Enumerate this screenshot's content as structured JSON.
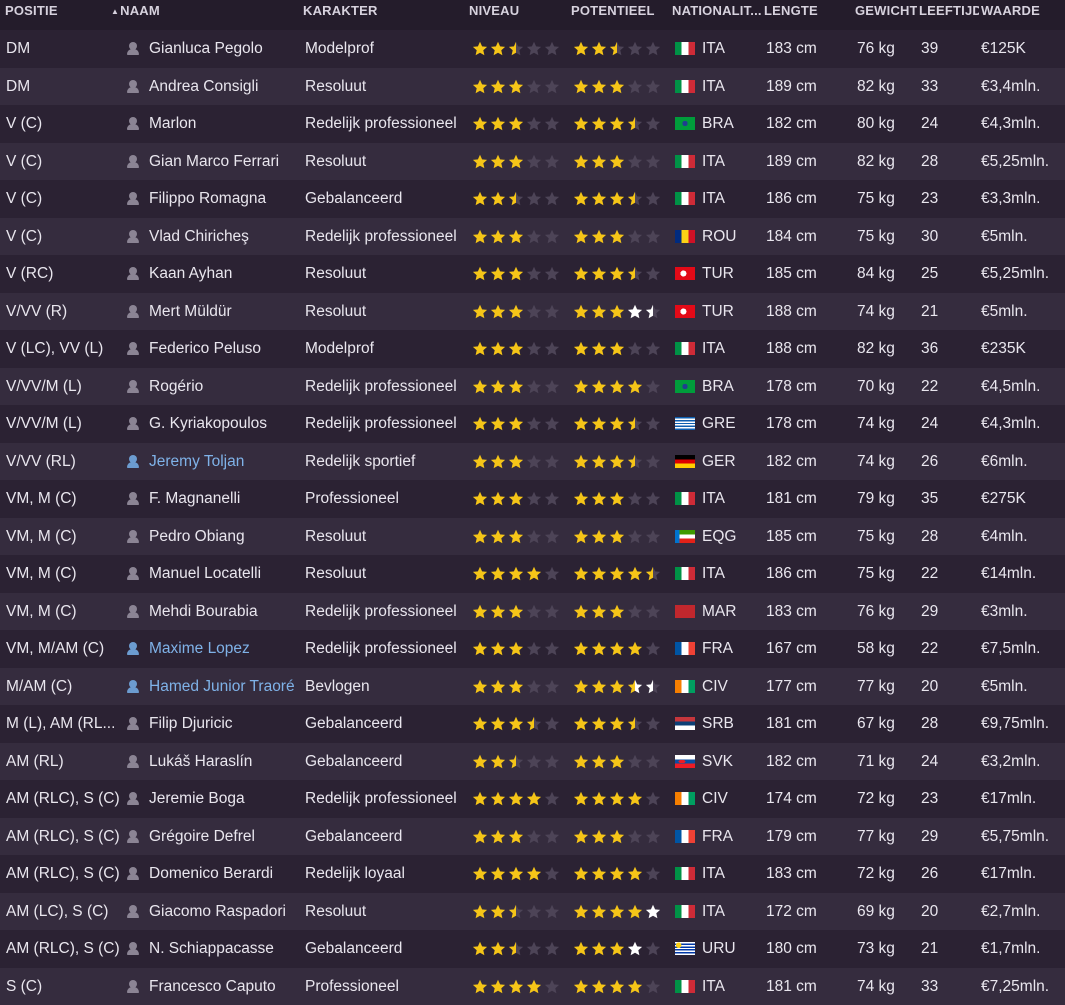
{
  "columns": {
    "position": "POSITIE",
    "name": "NAAM",
    "personality": "KARAKTER",
    "ability": "NIVEAU",
    "potential": "POTENTIEEL",
    "nationality": "NATIONALIT...",
    "height": "LENGTE",
    "weight": "GEWICHT",
    "age": "LEEFTIJD",
    "value": "WAARDE"
  },
  "sort": {
    "column": "name",
    "icon": "sort-ascending-icon"
  },
  "colors": {
    "star_gold": "#f5c518",
    "star_white": "#ffffff",
    "star_empty": "#4d4457",
    "link_blue": "#7fb2e8",
    "row_dark": "#2b2233",
    "row_light": "#352c3e"
  },
  "players": [
    {
      "pos": "DM",
      "name": "Gianluca Pegolo",
      "personality": "Modelprof",
      "ability": 2.5,
      "potential": 2.5,
      "pot_known": true,
      "nat": "ITA",
      "height": "183 cm",
      "weight": "76 kg",
      "age": "39",
      "value": "€125K"
    },
    {
      "pos": "DM",
      "name": "Andrea Consigli",
      "personality": "Resoluut",
      "ability": 3,
      "potential": 3,
      "pot_known": true,
      "nat": "ITA",
      "height": "189 cm",
      "weight": "82 kg",
      "age": "33",
      "value": "€3,4mln."
    },
    {
      "pos": "V (C)",
      "name": "Marlon",
      "personality": "Redelijk professioneel",
      "ability": 3,
      "potential": 3.5,
      "pot_known": true,
      "nat": "BRA",
      "height": "182 cm",
      "weight": "80 kg",
      "age": "24",
      "value": "€4,3mln."
    },
    {
      "pos": "V (C)",
      "name": "Gian Marco Ferrari",
      "personality": "Resoluut",
      "ability": 3,
      "potential": 3,
      "pot_known": true,
      "nat": "ITA",
      "height": "189 cm",
      "weight": "82 kg",
      "age": "28",
      "value": "€5,25mln."
    },
    {
      "pos": "V (C)",
      "name": "Filippo Romagna",
      "personality": "Gebalanceerd",
      "ability": 2.5,
      "potential": 3.5,
      "pot_known": true,
      "nat": "ITA",
      "height": "186 cm",
      "weight": "75 kg",
      "age": "23",
      "value": "€3,3mln."
    },
    {
      "pos": "V (C)",
      "name": "Vlad Chiricheş",
      "personality": "Redelijk professioneel",
      "ability": 3,
      "potential": 3,
      "pot_known": true,
      "nat": "ROU",
      "height": "184 cm",
      "weight": "75 kg",
      "age": "30",
      "value": "€5mln."
    },
    {
      "pos": "V (RC)",
      "name": "Kaan Ayhan",
      "personality": "Resoluut",
      "ability": 3,
      "potential": 3.5,
      "pot_known": true,
      "nat": "TUR",
      "height": "185 cm",
      "weight": "84 kg",
      "age": "25",
      "value": "€5,25mln."
    },
    {
      "pos": "V/VV (R)",
      "name": "Mert Müldür",
      "personality": "Resoluut",
      "ability": 3,
      "potential": 3,
      "pot_max": 4.5,
      "pot_known": false,
      "nat": "TUR",
      "height": "188 cm",
      "weight": "74 kg",
      "age": "21",
      "value": "€5mln."
    },
    {
      "pos": "V (LC), VV (L)",
      "name": "Federico Peluso",
      "personality": "Modelprof",
      "ability": 3,
      "potential": 3,
      "pot_known": true,
      "nat": "ITA",
      "height": "188 cm",
      "weight": "82 kg",
      "age": "36",
      "value": "€235K"
    },
    {
      "pos": "V/VV/M (L)",
      "name": "Rogério",
      "personality": "Redelijk professioneel",
      "ability": 3,
      "potential": 4,
      "pot_known": true,
      "nat": "BRA",
      "height": "178 cm",
      "weight": "70 kg",
      "age": "22",
      "value": "€4,5mln."
    },
    {
      "pos": "V/VV/M (L)",
      "name": "G. Kyriakopoulos",
      "personality": "Redelijk professioneel",
      "ability": 3,
      "potential": 3.5,
      "pot_known": true,
      "nat": "GRE",
      "height": "178 cm",
      "weight": "74 kg",
      "age": "24",
      "value": "€4,3mln."
    },
    {
      "pos": "V/VV (RL)",
      "name": "Jeremy Toljan",
      "personality": "Redelijk sportief",
      "ability": 3,
      "potential": 3.5,
      "pot_known": true,
      "link": true,
      "nat": "GER",
      "height": "182 cm",
      "weight": "74 kg",
      "age": "26",
      "value": "€6mln."
    },
    {
      "pos": "VM, M (C)",
      "name": "F. Magnanelli",
      "personality": "Professioneel",
      "ability": 3,
      "potential": 3,
      "pot_known": true,
      "nat": "ITA",
      "height": "181 cm",
      "weight": "79 kg",
      "age": "35",
      "value": "€275K"
    },
    {
      "pos": "VM, M (C)",
      "name": "Pedro Obiang",
      "personality": "Resoluut",
      "ability": 3,
      "potential": 3,
      "pot_known": true,
      "nat": "EQG",
      "height": "185 cm",
      "weight": "75 kg",
      "age": "28",
      "value": "€4mln."
    },
    {
      "pos": "VM, M (C)",
      "name": "Manuel Locatelli",
      "personality": "Resoluut",
      "ability": 4,
      "potential": 4.5,
      "pot_known": true,
      "nat": "ITA",
      "height": "186 cm",
      "weight": "75 kg",
      "age": "22",
      "value": "€14mln."
    },
    {
      "pos": "VM, M (C)",
      "name": "Mehdi Bourabia",
      "personality": "Redelijk professioneel",
      "ability": 3,
      "potential": 3,
      "pot_known": true,
      "nat": "MAR",
      "height": "183 cm",
      "weight": "76 kg",
      "age": "29",
      "value": "€3mln."
    },
    {
      "pos": "VM, M/AM (C)",
      "name": "Maxime Lopez",
      "personality": "Redelijk professioneel",
      "ability": 3,
      "potential": 4,
      "pot_known": true,
      "link": true,
      "nat": "FRA",
      "height": "167 cm",
      "weight": "58 kg",
      "age": "22",
      "value": "€7,5mln."
    },
    {
      "pos": "M/AM (C)",
      "name": "Hamed Junior Traoré",
      "personality": "Bevlogen",
      "ability": 3,
      "potential": 3.5,
      "pot_max": 4.5,
      "pot_known": false,
      "link": true,
      "nat": "CIV",
      "height": "177 cm",
      "weight": "77 kg",
      "age": "20",
      "value": "€5mln."
    },
    {
      "pos": "M (L), AM (RL...",
      "name": "Filip Djuricic",
      "personality": "Gebalanceerd",
      "ability": 3.5,
      "potential": 3.5,
      "pot_known": true,
      "nat": "SRB",
      "height": "181 cm",
      "weight": "67 kg",
      "age": "28",
      "value": "€9,75mln."
    },
    {
      "pos": "AM (RL)",
      "name": "Lukáš Haraslín",
      "personality": "Gebalanceerd",
      "ability": 2.5,
      "potential": 3,
      "pot_known": true,
      "nat": "SVK",
      "height": "182 cm",
      "weight": "71 kg",
      "age": "24",
      "value": "€3,2mln."
    },
    {
      "pos": "AM (RLC), S (C)",
      "name": "Jeremie Boga",
      "personality": "Redelijk professioneel",
      "ability": 4,
      "potential": 4,
      "pot_known": true,
      "nat": "CIV",
      "height": "174 cm",
      "weight": "72 kg",
      "age": "23",
      "value": "€17mln."
    },
    {
      "pos": "AM (RLC), S (C)",
      "name": "Grégoire Defrel",
      "personality": "Gebalanceerd",
      "ability": 3,
      "potential": 3,
      "pot_known": true,
      "nat": "FRA",
      "height": "179 cm",
      "weight": "77 kg",
      "age": "29",
      "value": "€5,75mln."
    },
    {
      "pos": "AM (RLC), S (C)",
      "name": "Domenico Berardi",
      "personality": "Redelijk loyaal",
      "ability": 4,
      "potential": 4,
      "pot_known": true,
      "nat": "ITA",
      "height": "183 cm",
      "weight": "72 kg",
      "age": "26",
      "value": "€17mln."
    },
    {
      "pos": "AM (LC), S (C)",
      "name": "Giacomo Raspadori",
      "personality": "Resoluut",
      "ability": 2.5,
      "potential": 4,
      "pot_max": 5,
      "pot_known": false,
      "nat": "ITA",
      "height": "172 cm",
      "weight": "69 kg",
      "age": "20",
      "value": "€2,7mln."
    },
    {
      "pos": "AM (RLC), S (C)",
      "name": "N. Schiappacasse",
      "personality": "Gebalanceerd",
      "ability": 2.5,
      "potential": 3,
      "pot_max": 4,
      "pot_known": false,
      "nat": "URU",
      "height": "180 cm",
      "weight": "73 kg",
      "age": "21",
      "value": "€1,7mln."
    },
    {
      "pos": "S (C)",
      "name": "Francesco Caputo",
      "personality": "Professioneel",
      "ability": 4,
      "potential": 4,
      "pot_known": true,
      "nat": "ITA",
      "height": "181 cm",
      "weight": "74 kg",
      "age": "33",
      "value": "€7,25mln."
    }
  ]
}
